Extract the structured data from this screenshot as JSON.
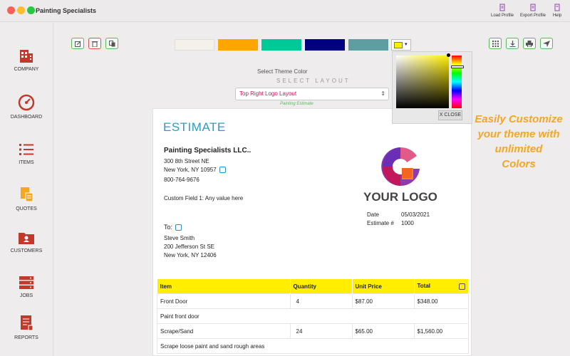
{
  "window": {
    "title": "Painting Specialists",
    "traffic_lights": [
      "#fe5f57",
      "#febc2e",
      "#28c840"
    ]
  },
  "toolbar": {
    "load_profile": "Load Profile",
    "export_profile": "Export Profile",
    "help": "Help"
  },
  "sidebar": {
    "accent": "#f5a623",
    "items": [
      {
        "label": "COMPANY",
        "icon": "building-icon",
        "color": "#c0392b"
      },
      {
        "label": "DASHBOARD",
        "icon": "speedometer-icon",
        "color": "#c0392b"
      },
      {
        "label": "ITEMS",
        "icon": "list-icon",
        "color": "#c0392b"
      },
      {
        "label": "QUOTES",
        "icon": "document-icon",
        "color": "#f5a623"
      },
      {
        "label": "CUSTOMERS",
        "icon": "folder-user-icon",
        "color": "#c0392b"
      },
      {
        "label": "JOBS",
        "icon": "server-icon",
        "color": "#c0392b"
      },
      {
        "label": "REPORTS",
        "icon": "report-icon",
        "color": "#c0392b"
      }
    ]
  },
  "theme": {
    "swatches": [
      "#f3f1ea",
      "#ffa500",
      "#00c896",
      "#000080",
      "#5f9ea0"
    ],
    "current_color": "#ffee00",
    "select_label": "Select Theme Color",
    "select_layout_heading": "SELECT LAYOUT",
    "layout_value": "Top Right Logo Layout",
    "layout_subtitle": "Painting Estimate",
    "picker_close": "X CLOSE"
  },
  "promo": {
    "text_line1": "Easily Customize",
    "text_line2": "your theme with",
    "text_line3": "unlimited",
    "text_line4": "Colors"
  },
  "estimate": {
    "heading": "ESTIMATE",
    "company_name": "Painting Specialists LLC..",
    "company_address1": "300 8th Street NE",
    "company_address2": "New York, NY 10957",
    "company_phone": "800-764-9676",
    "custom_field": "Custom Field 1: Any value here",
    "logo_text": "YOUR LOGO",
    "date_label": "Date",
    "date_value": "05/03/2021",
    "number_label": "Estimate #",
    "number_value": "1000",
    "to_label": "To:",
    "client_name": "Steve Smith",
    "client_address1": "200 Jefferson St SE",
    "client_address2": "New York, NY 12406",
    "table": {
      "headers": [
        "Item",
        "Quantity",
        "Unit Price",
        "Total"
      ],
      "rows": [
        {
          "item": "Front Door",
          "quantity": "4",
          "unit_price": "$87.00",
          "total": "$348.00"
        },
        {
          "description": "Paint front door"
        },
        {
          "item": "Scrape/Sand",
          "quantity": "24",
          "unit_price": "$65.00",
          "total": "$1,560.00"
        },
        {
          "description": "Scrape loose paint and sand rough areas"
        }
      ]
    }
  }
}
